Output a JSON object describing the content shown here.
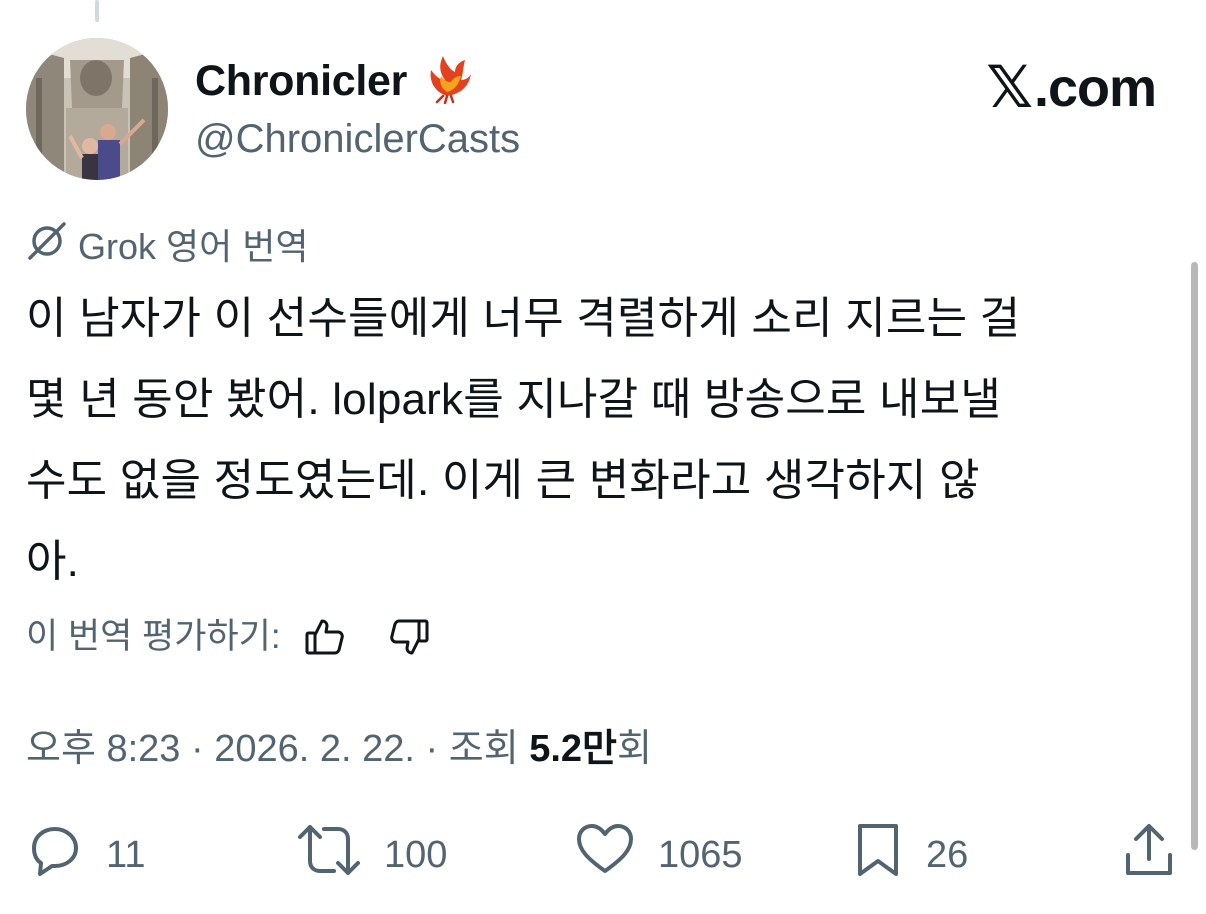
{
  "author": {
    "display_name": "Chronicler",
    "badge_icon": "phoenix-emoji",
    "handle": "@ChroniclerCasts"
  },
  "brand": {
    "x_glyph": "𝕏",
    "domain": ".com"
  },
  "translation": {
    "label": "Grok 영어 번역",
    "icon": "grok-icon"
  },
  "tweet": {
    "lines": [
      "이 남자가 이 선수들에게 너무 격렬하게 소리 지르는 걸",
      "몇 년 동안 봤어. lolpark를 지나갈 때 방송으로 내보낼",
      "수도 없을 정도였는데. 이게 큰 변화라고 생각하지 않",
      "아."
    ]
  },
  "rating": {
    "label": "이 번역 평가하기:",
    "thumbs_up_icon": "thumbs-up-icon",
    "thumbs_down_icon": "thumbs-down-icon"
  },
  "meta": {
    "time": "오후 8:23",
    "separator": " · ",
    "date": "2026. 2. 22.",
    "views_label": "조회 ",
    "views_count": "5.2만",
    "views_suffix": "회"
  },
  "actions": {
    "replies": "11",
    "reposts": "100",
    "likes": "1065",
    "bookmarks": "26"
  },
  "colors": {
    "text_primary": "#0f1419",
    "text_secondary": "#536471",
    "thread_line": "#cfd9de"
  }
}
